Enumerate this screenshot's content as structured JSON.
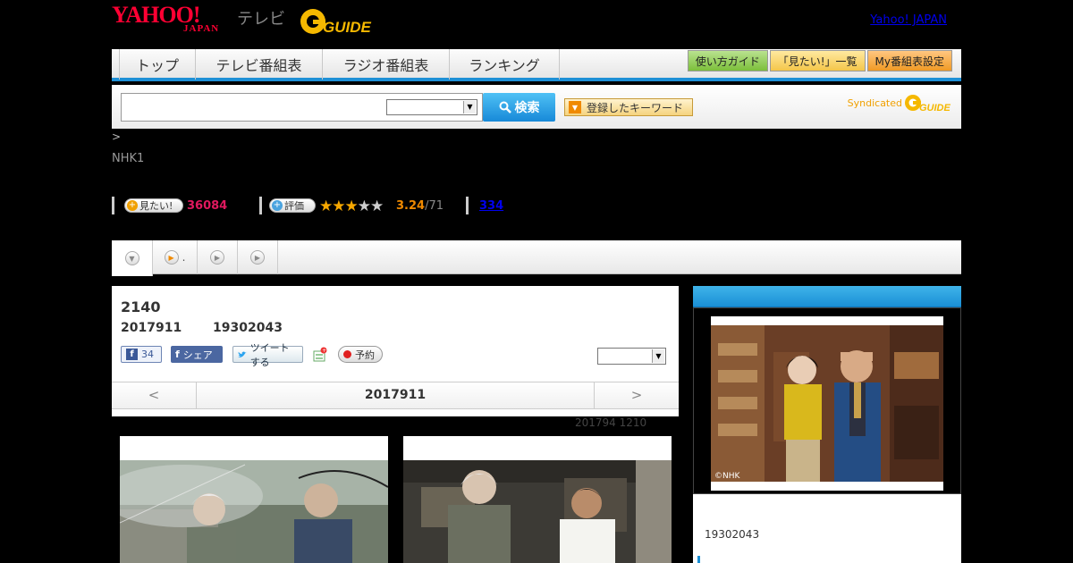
{
  "header": {
    "logo_yahoo": "YAHOO!",
    "logo_japan": "JAPAN",
    "logo_tv": "テレビ",
    "logo_gguide": "GUIDE",
    "yahoo_japan_link": "Yahoo! JAPAN"
  },
  "nav": {
    "tabs": [
      "トップ",
      "テレビ番組表",
      "ラジオ番組表",
      "ランキング"
    ],
    "right_buttons": [
      "使い方ガイド",
      "「見たい!」一覧",
      "My番組表設定"
    ]
  },
  "search": {
    "input_value": "",
    "select_value": "",
    "button_label": "検索",
    "keyword_button": "登録したキーワード",
    "syndicated_label": "Syndicated",
    "syndicated_brand": "GUIDE"
  },
  "breadcrumb": ">",
  "channel": "NHK1",
  "stats": {
    "mitai_label": "見たい!",
    "mitai_count": "36084",
    "hyoka_label": "評価",
    "stars_filled": 3,
    "stars_total": 5,
    "rating": "3.24",
    "rating_count": "/71",
    "link_count": "334"
  },
  "tabstrip": {
    "tab2_text": "."
  },
  "program": {
    "title": "2140",
    "date": "2017911",
    "time": "19302043",
    "fb_count": "34",
    "fb_share": "シェア",
    "tweet": "ツイートする",
    "reserve": "予約",
    "select_value": "",
    "pager_prev": "<",
    "pager_date": "2017911",
    "pager_next": ">",
    "updated": "201794  1210"
  },
  "side": {
    "image_credit": "©NHK",
    "time": "19302043"
  },
  "colors": {
    "brand_red": "#ff0033",
    "nav_blue": "#1e90d6",
    "count_pink": "#e0185e",
    "star_gold": "#f7a800"
  }
}
